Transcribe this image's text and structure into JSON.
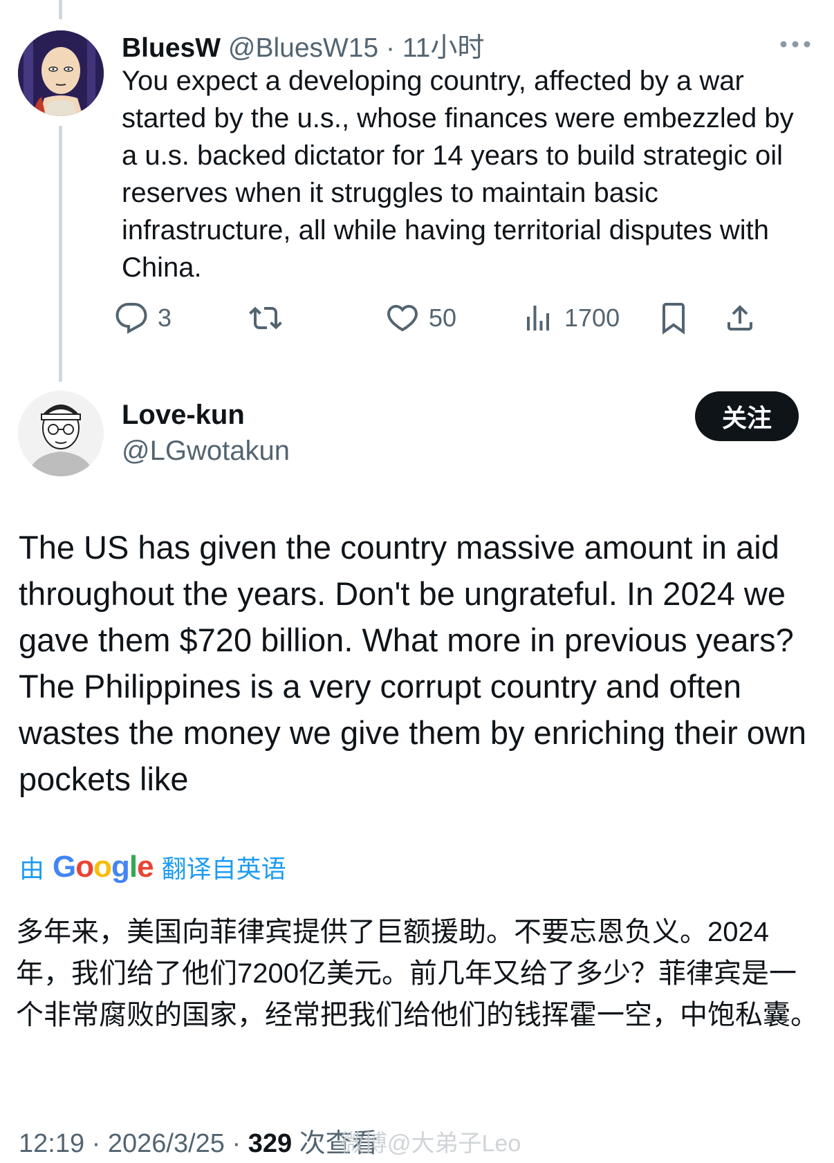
{
  "reply": {
    "display_name": "BluesW",
    "meta": "@BluesW15 · 11小时",
    "text": "You expect a developing country, affected by a war started by the u.s., whose finances were embezzled by a u.s. backed dictator for 14 years to build strategic oil reserves when it struggles to maintain basic infrastructure, all while having territorial disputes with China.",
    "actions": {
      "replies": "3",
      "likes": "50",
      "views": "1700"
    }
  },
  "post": {
    "display_name": "Love-kun",
    "handle": "@LGwotakun",
    "follow_label": "关注",
    "text": "The US has given the country massive amount in aid throughout the years. Don't be ungrateful. In 2024 we gave them $720 billion. What more in previous years? The Philippines is a very corrupt country and often wastes the money we give them by enriching their own pockets like",
    "translation": {
      "prefix": "由",
      "brand": "Google",
      "suffix": "翻译自英语",
      "text": "多年来，美国向菲律宾提供了巨额援助。不要忘恩负义。2024年，我们给了他们7200亿美元。前几年又给了多少？菲律宾是一个非常腐败的国家，经常把我们给他们的钱挥霍一空，中饱私囊。"
    },
    "footer": {
      "time": "12:19 · 2026/3/25 · ",
      "views": "329",
      "views_suffix": " 次查看"
    }
  },
  "watermark": "微博@大弟子Leo",
  "colors": {
    "accent": "#1d9bf0",
    "text": "#0f1419",
    "muted": "#536471"
  }
}
